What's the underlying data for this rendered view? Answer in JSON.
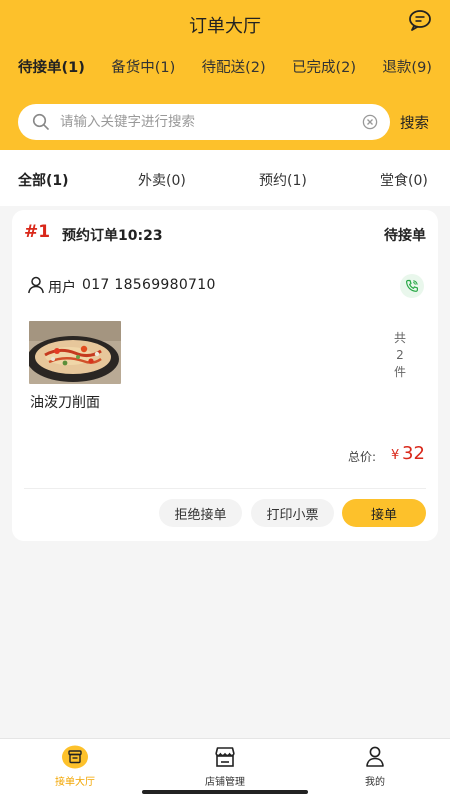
{
  "header": {
    "title": "订单大厅",
    "status_tabs": [
      {
        "label": "待接单(1)",
        "active": true
      },
      {
        "label": "备货中(1)",
        "active": false
      },
      {
        "label": "待配送(2)",
        "active": false
      },
      {
        "label": "已完成(2)",
        "active": false
      },
      {
        "label": "退款(9)",
        "active": false
      }
    ]
  },
  "search": {
    "placeholder": "请输入关键字进行搜索",
    "button_label": "搜索"
  },
  "type_tabs": [
    {
      "label": "全部(1)",
      "active": true
    },
    {
      "label": "外卖(0)",
      "active": false
    },
    {
      "label": "预约(1)",
      "active": false
    },
    {
      "label": "堂食(0)",
      "active": false
    }
  ],
  "order": {
    "number": "#1",
    "time": "预约订单10:23",
    "status": "待接单",
    "user_label": "用户",
    "user_phone": "017 18569980710",
    "item_name": "油泼刀削面",
    "quantity_lines": [
      "共",
      "2",
      "件"
    ],
    "total_label": "总价:",
    "total_currency": "¥",
    "total_amount": "32",
    "buttons": {
      "reject": "拒绝接单",
      "print": "打印小票",
      "accept": "接单"
    }
  },
  "tabbar": [
    {
      "label": "接单大厅",
      "icon": "order-hall-icon",
      "active": true
    },
    {
      "label": "店铺管理",
      "icon": "store-icon",
      "active": false
    },
    {
      "label": "我的",
      "icon": "person-icon",
      "active": false
    }
  ],
  "colors": {
    "brand": "#fdc12b",
    "price": "#d9281a",
    "active_tab": "#f2a500"
  }
}
